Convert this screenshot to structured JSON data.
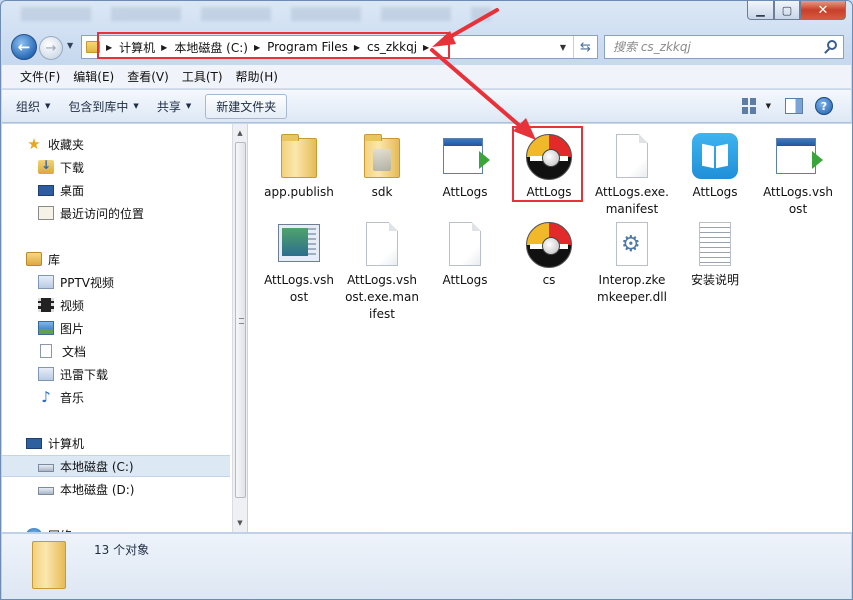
{
  "search": {
    "placeholder": "搜索 cs_zkkqj"
  },
  "address": {
    "crumbs": [
      "计算机",
      "本地磁盘 (C:)",
      "Program Files",
      "cs_zkkqj"
    ]
  },
  "menu": [
    "文件(F)",
    "编辑(E)",
    "查看(V)",
    "工具(T)",
    "帮助(H)"
  ],
  "toolbar": {
    "organize": "组织",
    "include": "包含到库中",
    "share": "共享",
    "new_folder": "新建文件夹"
  },
  "nav": {
    "favorites": "收藏夹",
    "downloads": "下载",
    "desktop": "桌面",
    "recent": "最近访问的位置",
    "libraries": "库",
    "pptv": "PPTV视频",
    "videos": "视频",
    "pictures": "图片",
    "documents": "文档",
    "xunlei": "迅雷下载",
    "music": "音乐",
    "computer": "计算机",
    "drive_c": "本地磁盘 (C:)",
    "drive_d": "本地磁盘 (D:)",
    "network": "网络"
  },
  "files": [
    {
      "name": "app.publish",
      "icon": "folder-icon"
    },
    {
      "name": "sdk",
      "icon": "folder-icon"
    },
    {
      "name": "AttLogs",
      "icon": "application-icon"
    },
    {
      "name": "AttLogs",
      "icon": "red-black-ball-icon"
    },
    {
      "name": "AttLogs.exe.manifest",
      "icon": "blank-file-icon"
    },
    {
      "name": "AttLogs",
      "icon": "blue-book-icon"
    },
    {
      "name": "AttLogs.vshost",
      "icon": "application-icon"
    },
    {
      "name": "AttLogs.vshost",
      "icon": "screen-icon"
    },
    {
      "name": "AttLogs.vshost.exe.manifest",
      "icon": "blank-file-icon"
    },
    {
      "name": "AttLogs",
      "icon": "blank-file-icon"
    },
    {
      "name": "cs",
      "icon": "red-black-ball-icon"
    },
    {
      "name": "Interop.zkemkeeper.dll",
      "icon": "dll-icon"
    },
    {
      "name": "安装说明",
      "icon": "text-file-icon"
    }
  ],
  "status": {
    "count": "13 个对象"
  },
  "colors": {
    "annotation": "#e8323a",
    "window_frame": "#c9daf0"
  }
}
